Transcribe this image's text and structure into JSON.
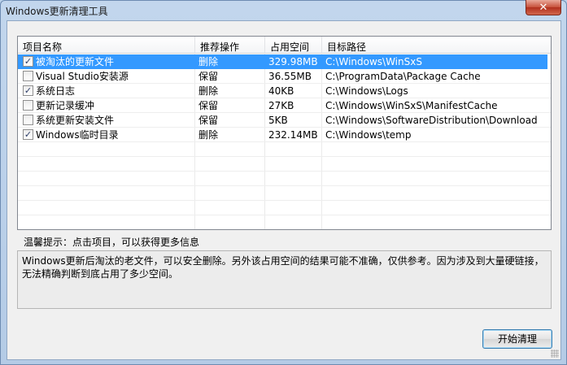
{
  "window": {
    "title": "Windows更新清理工具",
    "close_glyph": "✕"
  },
  "list": {
    "columns": [
      "项目名称",
      "推荐操作",
      "占用空间",
      "目标路径"
    ],
    "rows": [
      {
        "checked": true,
        "name": "被淘汰的更新文件",
        "action": "删除",
        "size": "329.98MB",
        "path": "C:\\Windows\\WinSxS",
        "selected": true
      },
      {
        "checked": false,
        "name": "Visual Studio安装源",
        "action": "保留",
        "size": "36.55MB",
        "path": "C:\\ProgramData\\Package Cache",
        "selected": false
      },
      {
        "checked": true,
        "name": "系统日志",
        "action": "删除",
        "size": "40KB",
        "path": "C:\\Windows\\Logs",
        "selected": false
      },
      {
        "checked": false,
        "name": "更新记录缓冲",
        "action": "保留",
        "size": "27KB",
        "path": "C:\\Windows\\WinSxS\\ManifestCache",
        "selected": false
      },
      {
        "checked": false,
        "name": "系统更新安装文件",
        "action": "保留",
        "size": "5KB",
        "path": "C:\\Windows\\SoftwareDistribution\\Download",
        "selected": false
      },
      {
        "checked": true,
        "name": "Windows临时目录",
        "action": "删除",
        "size": "232.14MB",
        "path": "C:\\Windows\\temp",
        "selected": false
      }
    ]
  },
  "hint": {
    "label": "温馨提示：点击项目，可以获得更多信息"
  },
  "description": {
    "text": "Windows更新后淘汰的老文件，可以安全删除。另外该占用空间的结果可能不准确，仅供参考。因为涉及到大量硬链接，\n无法精确判断到底占用了多少空间。"
  },
  "buttons": {
    "start_label": "开始清理"
  },
  "colors": {
    "selection": "#3399ff",
    "window_frame": "#b4cbe6"
  }
}
